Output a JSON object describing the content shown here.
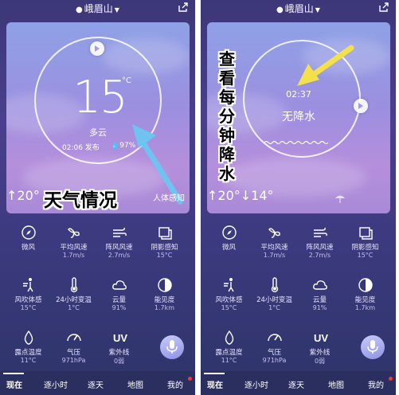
{
  "location": "峨眉山",
  "left": {
    "temperature": "15",
    "degree_symbol": "°C",
    "condition": "多云",
    "publish_time": "02:06 发布",
    "humidity": "97%",
    "high": "↑20°",
    "low": "↓",
    "feels_like": "人体感知",
    "overlay_label": "天气情况"
  },
  "right": {
    "time": "02:37",
    "precip_status": "无降水",
    "high": "↑20°",
    "low": "↓14°",
    "overlay_label": [
      "查",
      "看",
      "每",
      "分",
      "钟",
      "降",
      "水"
    ]
  },
  "metrics": [
    {
      "icon": "compass-icon",
      "label": "微风",
      "value": ""
    },
    {
      "icon": "wind-icon",
      "label": "平均风速",
      "value": "1.7m/s"
    },
    {
      "icon": "gust-icon",
      "label": "阵风风速",
      "value": "2.7m/s"
    },
    {
      "icon": "shade-icon",
      "label": "阴影感知",
      "value": "15°C"
    },
    {
      "icon": "wind-chill-icon",
      "label": "风吹体感",
      "value": "15°C"
    },
    {
      "icon": "thermometer-icon",
      "label": "24小时变温",
      "value": "1°C"
    },
    {
      "icon": "cloud-icon",
      "label": "云量",
      "value": "91%"
    },
    {
      "icon": "visibility-icon",
      "label": "能见度",
      "value": "1.7km"
    },
    {
      "icon": "dewpoint-icon",
      "label": "露点温度",
      "value": "11°C"
    },
    {
      "icon": "pressure-icon",
      "label": "气压",
      "value": "971hPa"
    },
    {
      "icon": "uv-icon",
      "label": "紫外线",
      "value": "0弱"
    }
  ],
  "tabs": [
    "现在",
    "逐小时",
    "逐天",
    "地图",
    "我的"
  ],
  "colors": {
    "accent_arrow_blue": "#6fc3f0",
    "accent_arrow_yellow": "#f4e04a",
    "notification": "#e93b3b"
  }
}
